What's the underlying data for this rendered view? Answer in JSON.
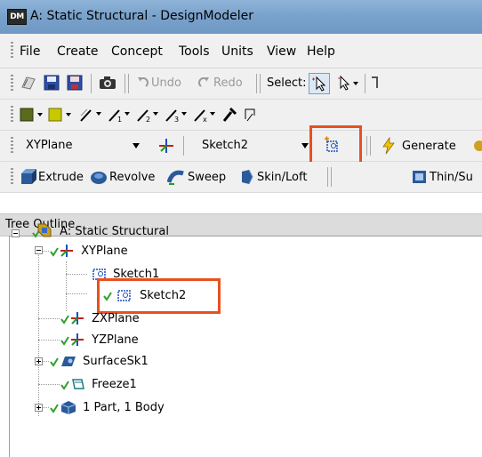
{
  "window": {
    "app_badge": "DM",
    "title": "A: Static Structural - DesignModeler"
  },
  "menu": [
    "File",
    "Create",
    "Concept",
    "Tools",
    "Units",
    "View",
    "Help"
  ],
  "toolbar1": {
    "undo": "Undo",
    "redo": "Redo",
    "select": "Select:"
  },
  "toolbar3": {
    "plane_value": "XYPlane",
    "sketch_value": "Sketch2",
    "generate": "Generate"
  },
  "toolbar4": {
    "extrude": "Extrude",
    "revolve": "Revolve",
    "sweep": "Sweep",
    "skin_loft": "Skin/Loft",
    "thin_surface": "Thin/Su"
  },
  "tree": {
    "header": "Tree Outline",
    "nodes": [
      {
        "label": "A: Static Structural",
        "icon": "model-icon"
      },
      {
        "label": "XYPlane",
        "icon": "plane-axes-icon"
      },
      {
        "label": "Sketch1",
        "icon": "sketch-icon"
      },
      {
        "label": "Sketch2",
        "icon": "sketch-icon"
      },
      {
        "label": "ZXPlane",
        "icon": "plane-axes-icon"
      },
      {
        "label": "YZPlane",
        "icon": "plane-axes-icon"
      },
      {
        "label": "SurfaceSk1",
        "icon": "surface-sketch-icon"
      },
      {
        "label": "Freeze1",
        "icon": "freeze-icon"
      },
      {
        "label": "1 Part, 1 Body",
        "icon": "part-body-icon"
      }
    ]
  },
  "colors": {
    "highlight": "#e8501f",
    "check": "#2ea02e",
    "titlebar": "#7aa3cc"
  }
}
